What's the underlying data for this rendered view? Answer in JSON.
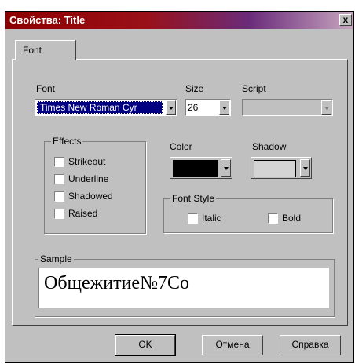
{
  "window": {
    "title": "Свойства: Title",
    "close_glyph": "x",
    "titlebar_colors": [
      "#8b0000",
      "#6a2b7a"
    ]
  },
  "tabs": [
    {
      "label": "Font",
      "selected": true
    }
  ],
  "font": {
    "label": "Font",
    "value": "Times New Roman Cyr",
    "selection_color": "#000080"
  },
  "size": {
    "label": "Size",
    "value": "26"
  },
  "script": {
    "label": "Script",
    "value": ""
  },
  "effects": {
    "title": "Effects",
    "items": [
      {
        "label": "Strikeout",
        "checked": false
      },
      {
        "label": "Underline",
        "checked": false
      },
      {
        "label": "Shadowed",
        "checked": false
      },
      {
        "label": "Raised",
        "checked": false
      }
    ]
  },
  "color": {
    "label": "Color",
    "value": "#000000"
  },
  "shadow": {
    "label": "Shadow",
    "value": "#d4d4d4"
  },
  "font_style": {
    "title": "Font Style",
    "italic": {
      "label": "Italic",
      "checked": false
    },
    "bold": {
      "label": "Bold",
      "checked": false
    }
  },
  "sample": {
    "title": "Sample",
    "text": "Общежитие№7Со"
  },
  "buttons": {
    "ok": "OK",
    "cancel": "Отмена",
    "help": "Справка"
  }
}
